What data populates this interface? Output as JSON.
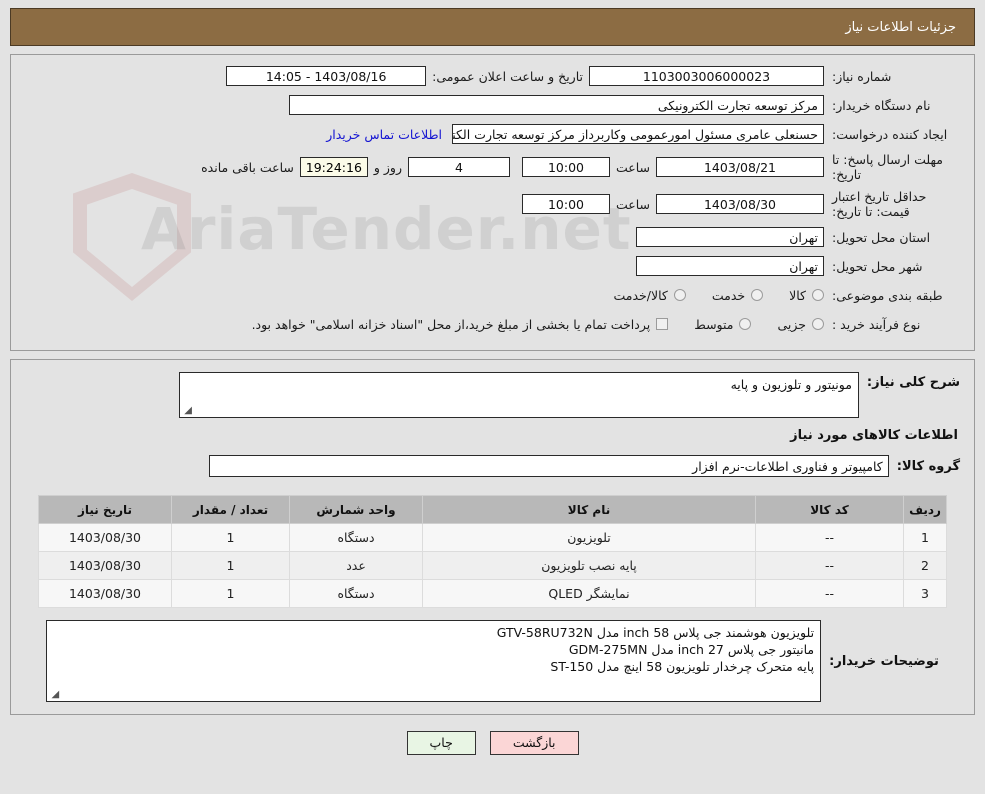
{
  "header": {
    "title": "جزئیات اطلاعات نیاز"
  },
  "watermark": {
    "text": "AriaTender.net"
  },
  "form": {
    "need_number_label": "شماره نیاز:",
    "need_number_value": "1103003006000023",
    "public_announce_label": "تاریخ و ساعت اعلان عمومی:",
    "public_announce_value": "1403/08/16 - 14:05",
    "buyer_org_label": "نام دستگاه خریدار:",
    "buyer_org_value": "مرکز توسعه تجارت الکترونیکی",
    "creator_label": "ایجاد کننده درخواست:",
    "creator_value": "حسنعلی عامری مسئول امورعمومی وکاربرداز مرکز توسعه تجارت الکترونیکی",
    "contact_link": "اطلاعات تماس خریدار",
    "deadline_label": "مهلت ارسال پاسخ: تا تاریخ:",
    "deadline_date": "1403/08/21",
    "hour_label": "ساعت",
    "deadline_time": "10:00",
    "remaining_days": "4",
    "remaining_days_label": "روز و",
    "remaining_timer": "19:24:16",
    "remaining_suffix": "ساعت باقی مانده",
    "price_validity_label": "حداقل تاریخ اعتبار قیمت: تا تاریخ:",
    "price_validity_date": "1403/08/30",
    "price_validity_time": "10:00",
    "province_label": "استان محل تحویل:",
    "province_value": "تهران",
    "city_label": "شهر محل تحویل:",
    "city_value": "تهران",
    "category_label": "طبقه بندی موضوعی:",
    "category_options": [
      "کالا",
      "خدمت",
      "کالا/خدمت"
    ],
    "process_label": "نوع فرآیند خرید :",
    "process_options": [
      "جزیی",
      "متوسط"
    ],
    "treasury_note": "پرداخت تمام یا بخشی از مبلغ خرید،از محل \"اسناد خزانه اسلامی\" خواهد بود."
  },
  "need": {
    "summary_label": "شرح کلی نیاز:",
    "summary_value": "مونیتور و تلوزیون و پایه",
    "goods_section_title": "اطلاعات کالاهای مورد نیاز",
    "group_label": "گروه کالا:",
    "group_value": "کامپیوتر و فناوری اطلاعات-نرم افزار"
  },
  "table": {
    "columns": [
      "ردیف",
      "کد کالا",
      "نام کالا",
      "واحد شمارش",
      "تعداد / مقدار",
      "تاریخ نیاز"
    ],
    "rows": [
      {
        "radif": "1",
        "code": "--",
        "name": "تلویزیون",
        "unit": "دستگاه",
        "qty": "1",
        "date": "1403/08/30"
      },
      {
        "radif": "2",
        "code": "--",
        "name": "پایه نصب تلویزیون",
        "unit": "عدد",
        "qty": "1",
        "date": "1403/08/30"
      },
      {
        "radif": "3",
        "code": "--",
        "name": "نمایشگر QLED",
        "unit": "دستگاه",
        "qty": "1",
        "date": "1403/08/30"
      }
    ]
  },
  "buyer_desc": {
    "label": "توضیحات خریدار:",
    "lines": [
      "تلویزیون هوشمند جی پلاس 58 inch  مدل GTV-58RU732N",
      "مانیتور جی پلاس 27 inch مدل GDM-275MN",
      "پایه متحرک چرخدار تلویزیون 58 اینچ مدل ST-150"
    ]
  },
  "footer": {
    "print_label": "چاپ",
    "back_label": "بازگشت"
  },
  "colors": {
    "header_bg": "#8c6c43",
    "page_bg": "#e3e3e3",
    "link": "#1414d2",
    "table_header_bg": "#b8b8b8",
    "timer_bg": "#fbfbe8",
    "print_btn_bg": "#e8f5e4",
    "back_btn_bg": "#fbd6d6"
  }
}
